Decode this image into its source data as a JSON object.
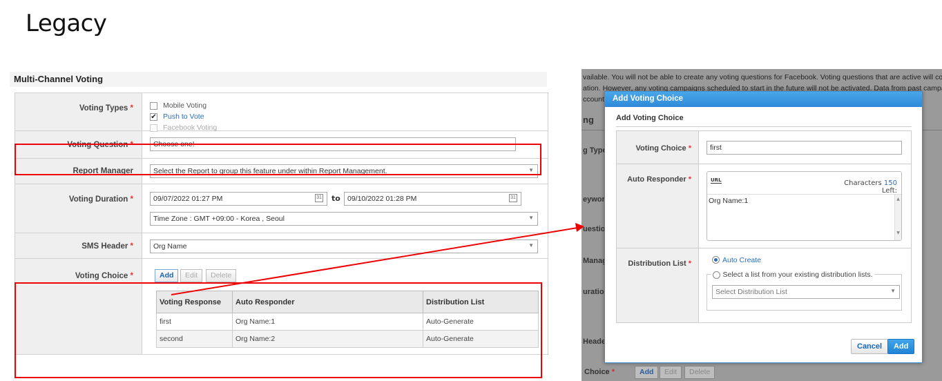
{
  "page": {
    "title": "Legacy"
  },
  "left": {
    "header": "Multi-Channel Voting",
    "voting_types": {
      "label": "Voting Types",
      "options": [
        {
          "label": "Mobile Voting",
          "checked": false,
          "disabled": false
        },
        {
          "label": "Push to Vote",
          "checked": true,
          "disabled": false
        },
        {
          "label": "Facebook Voting",
          "checked": false,
          "disabled": true
        }
      ]
    },
    "voting_question": {
      "label": "Voting Question",
      "value": "Choose one!"
    },
    "report_manager": {
      "label": "Report Manager",
      "value": "Select the Report to group this feature under within Report Management."
    },
    "voting_duration": {
      "label": "Voting Duration",
      "start": "09/07/2022 01:27 PM",
      "to": "to",
      "end": "09/10/2022 01:28 PM",
      "timezone": "Time Zone : GMT +09:00 - Korea , Seoul"
    },
    "sms_header": {
      "label": "SMS Header",
      "value": "Org Name"
    },
    "voting_choice": {
      "label": "Voting Choice",
      "buttons": {
        "add": "Add",
        "edit": "Edit",
        "delete": "Delete"
      },
      "columns": [
        "Voting Response",
        "Auto Responder",
        "Distribution List"
      ],
      "rows": [
        [
          "first",
          "Org Name:1",
          "Auto-Generate"
        ],
        [
          "second",
          "Org Name:2",
          "Auto-Generate"
        ]
      ]
    },
    "required_mark": "*"
  },
  "right": {
    "bg": {
      "line1": "vailable. You will not be able to create any voting questions for Facebook. Voting questions that are active will continue to",
      "line2": "ation. However, any voting campaigns scheduled to start in the future will not be activated. Data from past campaigns will",
      "line3": "ccount.",
      "header_frag": "ng",
      "labels": [
        "g Type",
        "eywor",
        "uestio",
        "Manag",
        "uratio",
        "Heade",
        "Choice"
      ],
      "buttons": {
        "add": "Add",
        "edit": "Edit",
        "delete": "Delete"
      }
    },
    "modal": {
      "title": "Add Voting Choice",
      "subtitle": "Add Voting Choice",
      "voting_choice": {
        "label": "Voting Choice",
        "value": "first"
      },
      "auto_responder": {
        "label": "Auto Responder",
        "chars_label": "Characters",
        "chars_count": "150",
        "chars_left": "Left:",
        "value": "Org Name:1"
      },
      "distribution_list": {
        "label": "Distribution List",
        "option_auto": "Auto Create",
        "option_existing": "Select a list from your existing distribution lists.",
        "select_placeholder": "Select Distribution List"
      },
      "buttons": {
        "cancel": "Cancel",
        "add": "Add"
      }
    }
  },
  "colors": {
    "annotation": "#e00000",
    "accent": "#2d8ad8",
    "required": "#e33333"
  }
}
